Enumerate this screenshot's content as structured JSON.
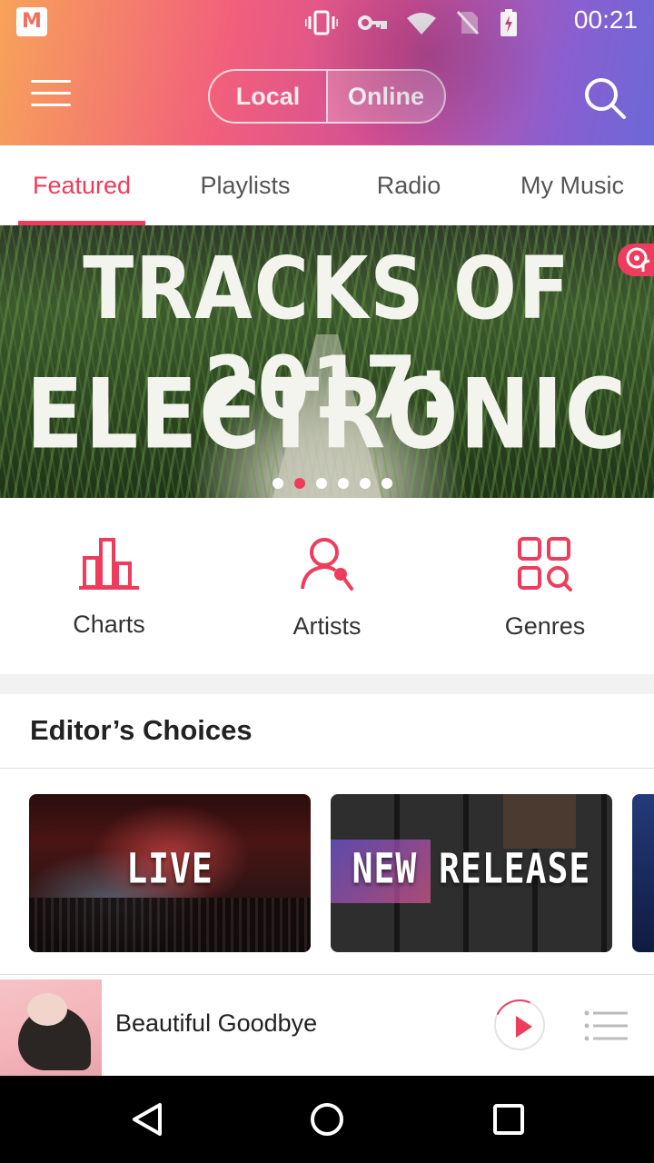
{
  "status_bar": {
    "app_badge": "M",
    "time": "00:21",
    "icons": [
      "vibrate-icon",
      "key-icon",
      "wifi-icon",
      "no-sim-icon",
      "battery-charging-icon"
    ]
  },
  "header": {
    "segments": {
      "local": "Local",
      "online": "Online",
      "selected": "Online"
    },
    "menu_icon": "hamburger-menu-icon",
    "search_icon": "search-icon"
  },
  "tabs": [
    {
      "label": "Featured",
      "active": true
    },
    {
      "label": "Playlists",
      "active": false
    },
    {
      "label": "Radio",
      "active": false
    },
    {
      "label": "My Music",
      "active": false
    }
  ],
  "banner": {
    "line1": "TRACKS OF 2017:",
    "line2": "ELECTRONIC",
    "page_count": 6,
    "active_page": 2
  },
  "quick_access": [
    {
      "label": "Charts",
      "icon": "bar-chart-icon"
    },
    {
      "label": "Artists",
      "icon": "artist-microphone-icon"
    },
    {
      "label": "Genres",
      "icon": "grid-search-icon"
    }
  ],
  "editors_choices": {
    "title": "Editor’s Choices",
    "cards": [
      {
        "label": "LIVE"
      },
      {
        "label": "NEW RELEASE"
      }
    ]
  },
  "player": {
    "track_title": "Beautiful Goodbye",
    "progress": 0.05
  },
  "colors": {
    "accent": "#ef3c5c",
    "header_gradient": [
      "#f7a25a",
      "#f15f7c",
      "#d14f95",
      "#8a5fcf",
      "#6c68d8"
    ]
  }
}
